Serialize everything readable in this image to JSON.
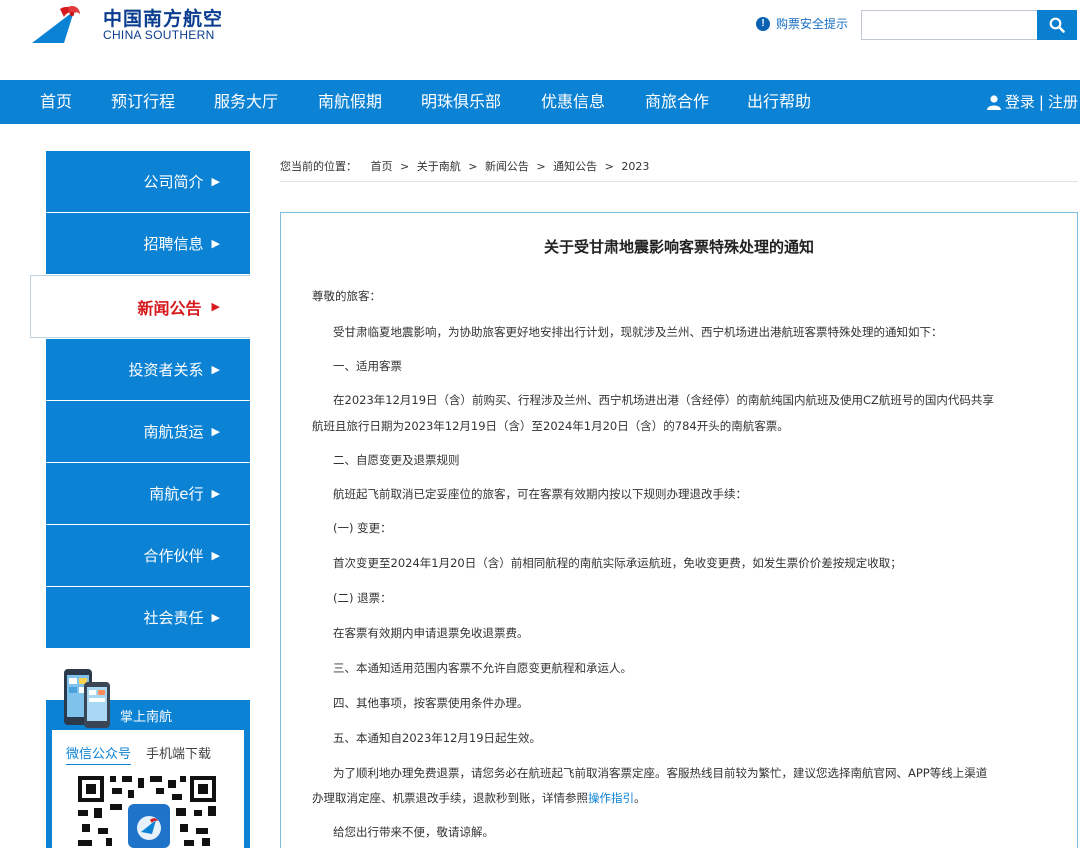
{
  "header": {
    "logo_cn": "中国南方航空",
    "logo_en": "CHINA SOUTHERN",
    "safety_tip": "购票安全提示",
    "search_placeholder": "",
    "search_icon": "magnifier-icon"
  },
  "nav": {
    "items": [
      "首页",
      "预订行程",
      "服务大厅",
      "南航假期",
      "明珠俱乐部",
      "优惠信息",
      "商旅合作",
      "出行帮助"
    ],
    "login": "登录",
    "separator": "|",
    "register": "注册"
  },
  "sidebar": {
    "items": [
      "公司简介",
      "招聘信息",
      "新闻公告",
      "投资者关系",
      "南航货运",
      "南航e行",
      "合作伙伴",
      "社会责任"
    ],
    "active_index": 2,
    "arrow": "▶"
  },
  "app_box": {
    "title": "掌上南航",
    "tab_wechat": "微信公众号",
    "tab_mobile": "手机端下载"
  },
  "breadcrumb": {
    "prefix": "您当前的位置：",
    "path": [
      "首页",
      "关于南航",
      "新闻公告",
      "通知公告",
      "2023"
    ],
    "sep": ">"
  },
  "article": {
    "title": "关于受甘肃地震影响客票特殊处理的通知",
    "greeting": "尊敬的旅客：",
    "p1": "受甘肃临夏地震影响，为协助旅客更好地安排出行计划，现就涉及兰州、西宁机场进出港航班客票特殊处理的通知如下：",
    "s1": "一、适用客票",
    "p2_line1": "在2023年12月19日（含）前购买、行程涉及兰州、西宁机场进出港（含经停）的南航纯国内航班及使用CZ航班号的国内代码共享",
    "p2_line2": "航班且旅行日期为2023年12月19日（含）至2024年1月20日（含）的784开头的南航客票。",
    "s2": "二、自愿变更及退票规则",
    "p3": "航班起飞前取消已定妥座位的旅客，可在客票有效期内按以下规则办理退改手续：",
    "s2a": "(一) 变更：",
    "p4": "首次变更至2024年1月20日（含）前相同航程的南航实际承运航班，免收变更费，如发生票价价差按规定收取；",
    "s2b": "(二) 退票：",
    "p5": "在客票有效期内申请退票免收退票费。",
    "s3": "三、本通知适用范围内客票不允许自愿变更航程和承运人。",
    "s4": "四、其他事项，按客票使用条件办理。",
    "s5": "五、本通知自2023年12月19日起生效。",
    "p6_line1": "为了顺利地办理免费退票，请您务必在航班起飞前取消客票定座。客服热线目前较为繁忙，建议您选择南航官网、APP等线上渠道",
    "p6_line2_prefix": "办理取消定座、机票退改手续，退款秒到账，详情参照",
    "p6_link": "操作指引",
    "p6_suffix": "。",
    "closing": "给您出行带来不便，敬请谅解。"
  }
}
